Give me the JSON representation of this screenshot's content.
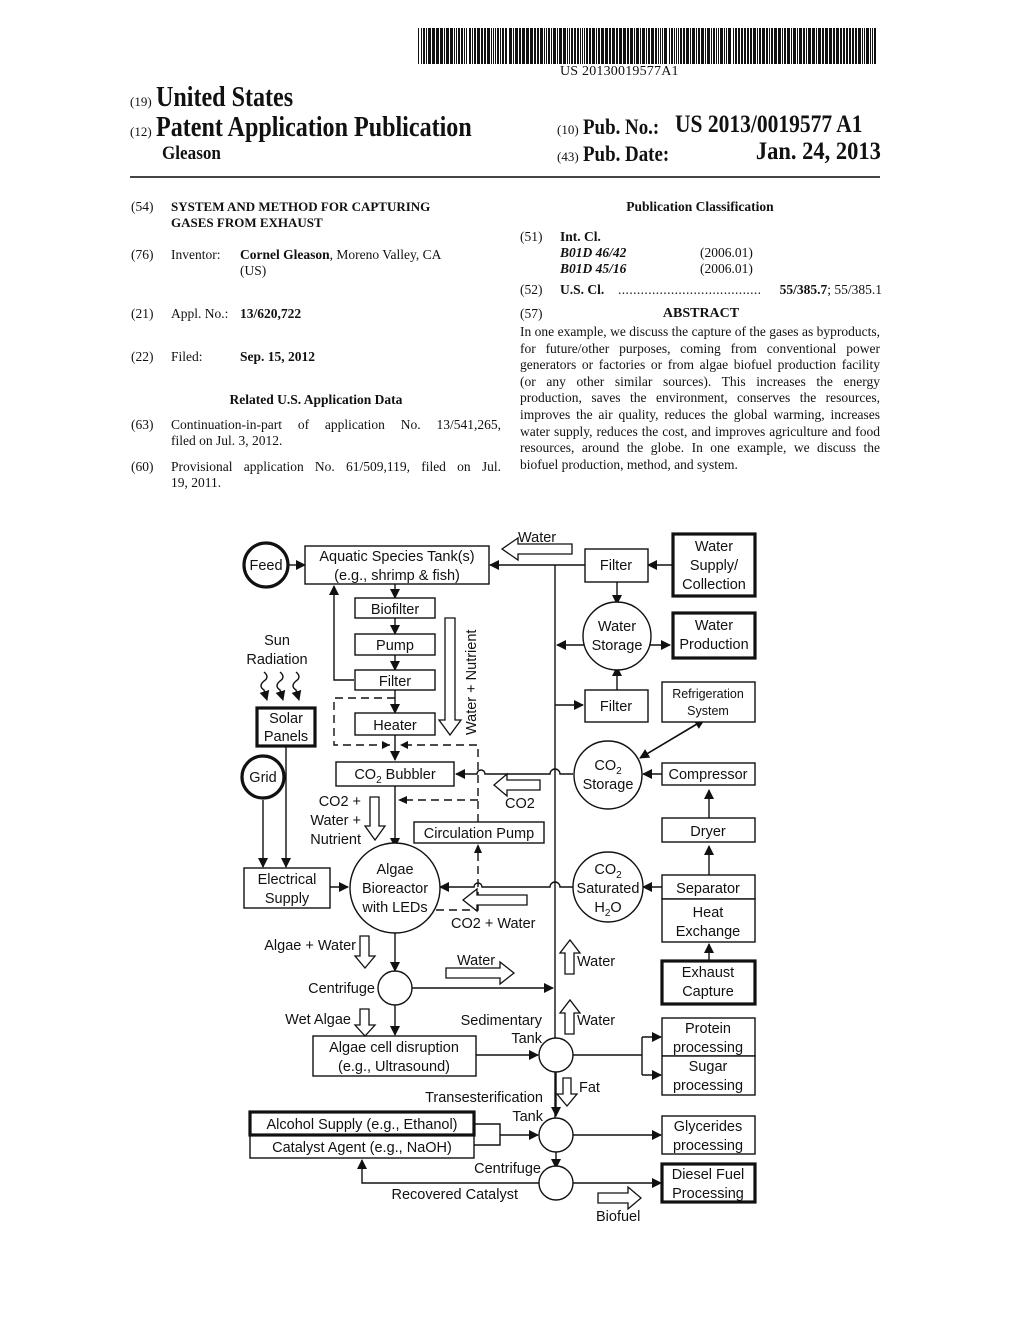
{
  "header": {
    "barcode_text": "US 20130019577A1",
    "country_code": "(19)",
    "country": "United States",
    "type_code": "(12)",
    "pub_type": "Patent Application Publication",
    "inventor_surname": "Gleason",
    "pub_no_code": "(10)",
    "pub_no_label": "Pub. No.:",
    "pub_no": "US 2013/0019577 A1",
    "pub_date_code": "(43)",
    "pub_date_label": "Pub. Date:",
    "pub_date": "Jan. 24, 2013"
  },
  "left_column": {
    "title_code": "(54)",
    "title_line1": "SYSTEM AND METHOD FOR CAPTURING",
    "title_line2": "GASES FROM EXHAUST",
    "inventor_code": "(76)",
    "inventor_label": "Inventor:",
    "inventor_name": "Cornel Gleason",
    "inventor_location": ", Moreno Valley, CA",
    "inventor_country": "(US)",
    "appl_code": "(21)",
    "appl_label": "Appl. No.:",
    "appl_no": "13/620,722",
    "filed_code": "(22)",
    "filed_label": "Filed:",
    "filed_date": "Sep. 15, 2012",
    "related_heading": "Related U.S. Application Data",
    "related": [
      {
        "code": "(63)",
        "line1": "Continuation-in-part of application No. 13/541,265,",
        "line2": "filed on Jul. 3, 2012."
      },
      {
        "code": "(60)",
        "line1": "Provisional application No. 61/509,119, filed on Jul.",
        "line2": "19, 2011."
      }
    ]
  },
  "right_column": {
    "classification_heading": "Publication Classification",
    "int_cl_code": "(51)",
    "int_cl_label": "Int. Cl.",
    "int_cl": [
      {
        "class": "B01D 46/42",
        "version": "(2006.01)"
      },
      {
        "class": "B01D 45/16",
        "version": "(2006.01)"
      }
    ],
    "us_cl_code": "(52)",
    "us_cl_label": "U.S. Cl.",
    "us_cl_dots": "......................................",
    "us_cl_primary": "55/385.7",
    "us_cl_secondary": "; 55/385.1",
    "abstract_code": "(57)",
    "abstract_heading": "ABSTRACT",
    "abstract": "In one example, we discuss the capture of the gases as byproducts, for future/other purposes, coming from conventional power generators or factories or from algae biofuel production facility (or any other similar sources). This increases the energy production, saves the environment, conserves the resources, improves the air quality, reduces the global warming, increases water supply, reduces the cost, and improves agriculture and food resources, around the globe. In one example, we discuss the biofuel production, method, and system."
  },
  "diagram": {
    "nodes": {
      "feed": "Feed",
      "aquatic_tank_1": "Aquatic Species Tank(s)",
      "aquatic_tank_2": "(e.g., shrimp & fish)",
      "biofilter": "Biofilter",
      "pump": "Pump",
      "filter_left": "Filter",
      "heater": "Heater",
      "sun_1": "Sun",
      "sun_2": "Radiation",
      "solar_1": "Solar",
      "solar_2": "Panels",
      "grid": "Grid",
      "co2_bubbler": "CO",
      "co2_bubbler_sub": "2",
      "co2_bubbler_rest": " Bubbler",
      "circulation_pump": "Circulation Pump",
      "electrical_1": "Electrical",
      "electrical_2": "Supply",
      "bioreactor_1": "Algae",
      "bioreactor_2": "Bioreactor",
      "bioreactor_3": "with LEDs",
      "centrifuge_1": "Centrifuge",
      "disruption_1": "Algae cell disruption",
      "disruption_2": "(e.g., Ultrasound)",
      "sedimentary_1": "Sedimentary",
      "sedimentary_2": "Tank",
      "transest_1": "Transesterification",
      "transest_2": "Tank",
      "centrifuge_2": "Centrifuge",
      "alcohol": "Alcohol Supply (e.g., Ethanol)",
      "catalyst": "Catalyst Agent (e.g., NaOH)",
      "recovered": "Recovered Catalyst",
      "filter_top": "Filter",
      "water_supply_1": "Water",
      "water_supply_2": "Supply/",
      "water_supply_3": "Collection",
      "water_storage_1": "Water",
      "water_storage_2": "Storage",
      "water_production_1": "Water",
      "water_production_2": "Production",
      "filter_mid": "Filter",
      "refrigeration_1": "Refrigeration",
      "refrigeration_2": "System",
      "co2_storage_1": "CO",
      "co2_storage_sub": "2",
      "co2_storage_2": "Storage",
      "compressor": "Compressor",
      "dryer": "Dryer",
      "co2_sat_1": "CO",
      "co2_sat_sub": "2",
      "co2_sat_2": "Saturated",
      "co2_sat_3": "H",
      "co2_sat_3_sub": "2",
      "co2_sat_3_rest": "O",
      "separator": "Separator",
      "heat_exchange_1": "Heat",
      "heat_exchange_2": "Exchange",
      "exhaust_1": "Exhaust",
      "exhaust_2": "Capture",
      "protein_1": "Protein",
      "protein_2": "processing",
      "sugar_1": "Sugar",
      "sugar_2": "processing",
      "glycerides_1": "Glycerides",
      "glycerides_2": "processing",
      "diesel_1": "Diesel Fuel",
      "diesel_2": "Processing"
    },
    "flow_labels": {
      "water_top": "Water",
      "water_nutrient": "Water + Nutrient",
      "co2": "CO2",
      "co2_water_nutrient_1": "CO2 +",
      "co2_water_nutrient_2": "Water +",
      "co2_water_nutrient_3": "Nutrient",
      "co2_water": "CO2 + Water",
      "algae_water": "Algae + Water",
      "water_centrifuge": "Water",
      "water_up_1": "Water",
      "water_up_2": "Water",
      "wet_algae": "Wet Algae",
      "fat": "Fat",
      "biofuel": "Biofuel"
    }
  }
}
